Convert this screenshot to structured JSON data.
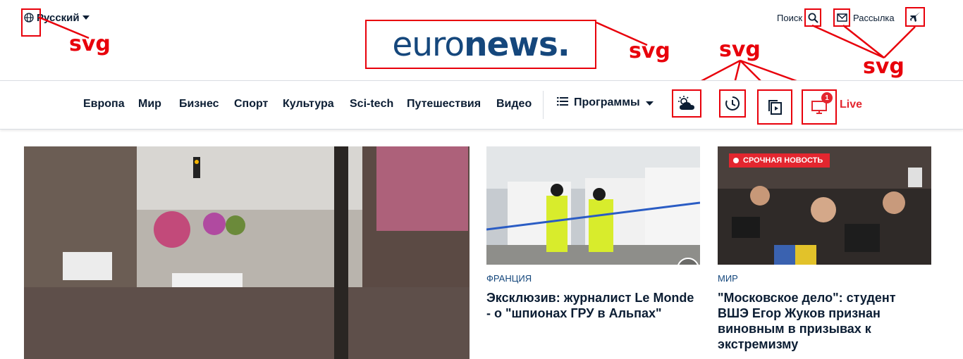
{
  "header": {
    "language": "Русский",
    "logo": {
      "light": "euro",
      "bold": "news",
      "dot": "."
    },
    "search_label": "Поиск",
    "newsletter_label": "Рассылка"
  },
  "annotations": {
    "lang_svg": "svg",
    "logo_svg": "svg",
    "nav_svg": "svg",
    "top_svg": "svg"
  },
  "nav": {
    "items": [
      "Европа",
      "Мир",
      "Бизнес",
      "Спорт",
      "Культура",
      "Sci-tech",
      "Путешествия",
      "Видео"
    ],
    "programs_label": "Программы",
    "live_label": "Live",
    "live_count": "1",
    "icons": [
      "weather-icon",
      "latest-news-icon",
      "stories-icon",
      "live-tv-icon"
    ]
  },
  "cards": [
    {
      "tag": "Франция",
      "title": "Эксклюзив: журналист Le Monde - о \"шпионах ГРУ в Альпах\""
    },
    {
      "tag": "Мир",
      "title": "\"Московское дело\": студент ВШЭ Егор Жуков признан виновным в призывах к экстремизму",
      "breaking_label": "Срочная новость"
    }
  ],
  "colors": {
    "brand_blue": "#15477c",
    "accent_red": "#e3262f",
    "annotation_red": "#e8000b"
  }
}
